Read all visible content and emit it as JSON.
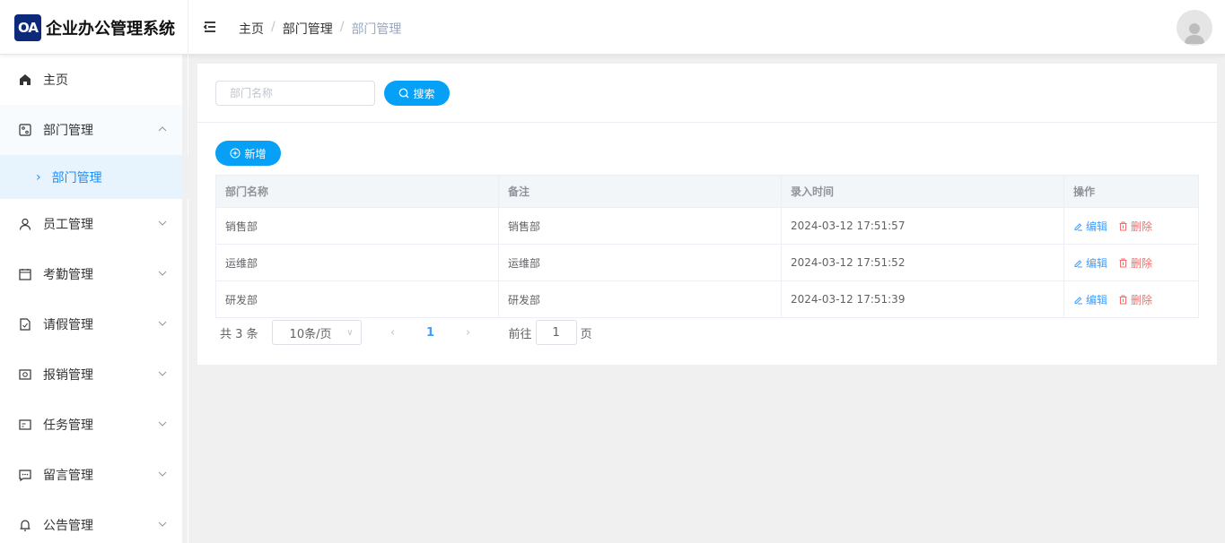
{
  "app": {
    "logo_badge": "OA",
    "title": "企业办公管理系统"
  },
  "breadcrumb": [
    "主页",
    "部门管理",
    "部门管理"
  ],
  "sidebar": {
    "items": [
      {
        "label": "主页",
        "icon": "home-icon"
      },
      {
        "label": "部门管理",
        "icon": "department-icon",
        "open": true,
        "children": [
          {
            "label": "部门管理"
          }
        ]
      },
      {
        "label": "员工管理",
        "icon": "user-icon"
      },
      {
        "label": "考勤管理",
        "icon": "calendar-icon"
      },
      {
        "label": "请假管理",
        "icon": "leave-icon"
      },
      {
        "label": "报销管理",
        "icon": "money-icon"
      },
      {
        "label": "任务管理",
        "icon": "task-icon"
      },
      {
        "label": "留言管理",
        "icon": "message-icon"
      },
      {
        "label": "公告管理",
        "icon": "bell-icon"
      }
    ]
  },
  "search": {
    "placeholder": "部门名称",
    "value": "",
    "button": "搜索"
  },
  "toolbar": {
    "add": "新增"
  },
  "table": {
    "columns": [
      "部门名称",
      "备注",
      "录入时间",
      "操作"
    ],
    "rows": [
      {
        "name": "销售部",
        "remark": "销售部",
        "time": "2024-03-12 17:51:57"
      },
      {
        "name": "运维部",
        "remark": "运维部",
        "time": "2024-03-12 17:51:52"
      },
      {
        "name": "研发部",
        "remark": "研发部",
        "time": "2024-03-12 17:51:39"
      }
    ],
    "edit": "编辑",
    "delete": "删除"
  },
  "pagination": {
    "total": "共 3 条",
    "page_size": "10条/页",
    "current": "1",
    "goto_prefix": "前往",
    "goto_value": "1",
    "goto_suffix": "页"
  },
  "colors": {
    "primary": "#06a0f6",
    "danger": "#f56c6c",
    "logo": "#0d2a7a"
  }
}
